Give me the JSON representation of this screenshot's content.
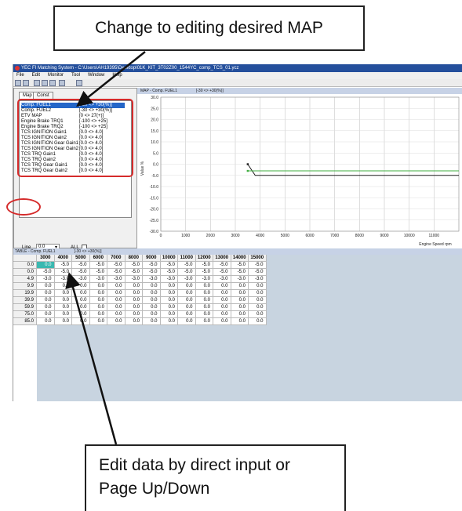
{
  "callouts": {
    "top": "Change to editing desired MAP",
    "bottom_line1": "Edit data by direct input or",
    "bottom_line2": "Page Up/Down"
  },
  "window": {
    "title": "YEC FI Matching System - C:\\Users\\AH19395\\Desktop\\01K_KIT_3T02Z00_1544YC_comp_TCS_01.ycz"
  },
  "menu": [
    "File",
    "Edit",
    "Monitor",
    "Tool",
    "Window",
    "Help"
  ],
  "left_pane": {
    "tabs": [
      "Map",
      "Const"
    ],
    "map_items": [
      {
        "name": "Comp. FUEL1",
        "range": "[-30 <> +30(%)]"
      },
      {
        "name": "Comp. FUEL2",
        "range": "[-30 <> +30(%)]"
      },
      {
        "name": "ETV MAP",
        "range": "[0 <> 27(+)]"
      },
      {
        "name": "Engine Brake TRQ1",
        "range": "[-100 <> +25]"
      },
      {
        "name": "Engine Brake TRQ2",
        "range": "[-100 <> +25]"
      },
      {
        "name": "TCS IGNITION Gain1",
        "range": "[0.0 <> 4.0]"
      },
      {
        "name": "TCS IGNITION Gain2",
        "range": "[0.0 <> 4.0]"
      },
      {
        "name": "TCS IGNITION Gear Gain1",
        "range": "[0.0 <> 4.0]"
      },
      {
        "name": "TCS IGNITION Gear Gain2",
        "range": "[0.0 <> 4.0]"
      },
      {
        "name": "TCS TRQ Gain1",
        "range": "[0.0 <> 4.0]"
      },
      {
        "name": "TCS TRQ Gain2",
        "range": "[0.0 <> 4.0]"
      },
      {
        "name": "TCS TRQ Gear Gain1",
        "range": "[0.0 <> 4.0]"
      },
      {
        "name": "TCS TRQ Gear Gain2",
        "range": "[0.0 <> 4.0]"
      }
    ],
    "line_label": "Line",
    "line_value": "0.0",
    "all_label": "ALL",
    "nav_buttons": [
      "≫",
      "∨",
      "∧",
      "≪"
    ]
  },
  "map_header": {
    "name": "MAP - Comp. FUEL1",
    "range": "[-30 <> +30(%)]"
  },
  "chart_data": {
    "type": "line",
    "xlabel": "Engine Speed rpm",
    "ylabel": "Value %",
    "xlim": [
      0,
      12000
    ],
    "ylim": [
      -30,
      30
    ],
    "x_ticks": [
      0,
      1000,
      2000,
      3000,
      4000,
      5000,
      6000,
      7000,
      8000,
      9000,
      10000,
      11000
    ],
    "y_ticks": [
      30,
      25,
      20,
      15,
      10,
      5,
      0,
      -5,
      -10,
      -15,
      -20,
      -25,
      -30
    ],
    "y_tick_labels": [
      "30.0",
      "25.0",
      "20.0",
      "15.0",
      "10.0",
      "5.0",
      "0.0",
      "-5.0",
      "-10.0",
      "-15.0",
      "-20.0",
      "-25.0",
      "-30.0"
    ],
    "series": [
      {
        "x": [
          3500,
          3800,
          12000
        ],
        "y": [
          0,
          -5,
          -5
        ],
        "color": "#1a1a1a"
      },
      {
        "x": [
          3500,
          12000
        ],
        "y": [
          -3,
          -3
        ],
        "color": "#3fae3f"
      }
    ],
    "grid": true
  },
  "table": {
    "header": {
      "name": "TABLE - Comp. FUEL1",
      "range": "[-30 <> +30(%)]"
    },
    "columns": [
      "3000",
      "4000",
      "5000",
      "6000",
      "7000",
      "8000",
      "9000",
      "10000",
      "11000",
      "12000",
      "13000",
      "14000",
      "15000"
    ],
    "rows": [
      {
        "label": "0.0",
        "values": [
          "0.0",
          "-5.0",
          "-5.0",
          "-5.0",
          "-5.0",
          "-5.0",
          "-5.0",
          "-5.0",
          "-5.0",
          "-5.0",
          "-5.0",
          "-5.0",
          "-5.0"
        ]
      },
      {
        "label": "0.0",
        "values": [
          "-5.0",
          "-5.0",
          "-5.0",
          "-5.0",
          "-5.0",
          "-5.0",
          "-5.0",
          "-5.0",
          "-5.0",
          "-5.0",
          "-5.0",
          "-5.0",
          "-5.0"
        ]
      },
      {
        "label": "4.9",
        "values": [
          "-3.0",
          "-3.0",
          "-3.0",
          "-3.0",
          "-3.0",
          "-3.0",
          "-3.0",
          "-3.0",
          "-3.0",
          "-3.0",
          "-3.0",
          "-3.0",
          "-3.0"
        ]
      },
      {
        "label": "9.9",
        "values": [
          "0.0",
          "0.0",
          "0.0",
          "0.0",
          "0.0",
          "0.0",
          "0.0",
          "0.0",
          "0.0",
          "0.0",
          "0.0",
          "0.0",
          "0.0"
        ]
      },
      {
        "label": "19.9",
        "values": [
          "0.0",
          "0.0",
          "0.0",
          "0.0",
          "0.0",
          "0.0",
          "0.0",
          "0.0",
          "0.0",
          "0.0",
          "0.0",
          "0.0",
          "0.0"
        ]
      },
      {
        "label": "39.9",
        "values": [
          "0.0",
          "0.0",
          "0.0",
          "0.0",
          "0.0",
          "0.0",
          "0.0",
          "0.0",
          "0.0",
          "0.0",
          "0.0",
          "0.0",
          "0.0"
        ]
      },
      {
        "label": "59.9",
        "values": [
          "0.0",
          "0.0",
          "0.0",
          "0.0",
          "0.0",
          "0.0",
          "0.0",
          "0.0",
          "0.0",
          "0.0",
          "0.0",
          "0.0",
          "0.0"
        ]
      },
      {
        "label": "75.0",
        "values": [
          "0.0",
          "0.0",
          "0.0",
          "0.0",
          "0.0",
          "0.0",
          "0.0",
          "0.0",
          "0.0",
          "0.0",
          "0.0",
          "0.0",
          "0.0"
        ]
      },
      {
        "label": "85.0",
        "values": [
          "0.0",
          "0.0",
          "0.0",
          "0.0",
          "0.0",
          "0.0",
          "0.0",
          "0.0",
          "0.0",
          "0.0",
          "0.0",
          "0.0",
          "0.0"
        ]
      }
    ]
  },
  "colors": {
    "title_bar": "#244f9c",
    "selection": "#2466c8",
    "highlight_red": "#d52b2b",
    "active_cell": "#3ab8b0",
    "header_blue": "#c7d2e6"
  }
}
